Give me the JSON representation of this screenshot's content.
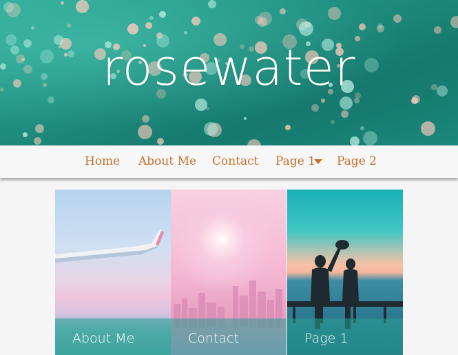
{
  "site": {
    "title": "rosewater"
  },
  "nav": {
    "items": [
      {
        "label": "Home"
      },
      {
        "label": "About Me"
      },
      {
        "label": "Contact"
      },
      {
        "label": "Page 1",
        "has_dropdown": true
      },
      {
        "label": "Page 2"
      }
    ]
  },
  "cards": [
    {
      "label": "About Me",
      "image": "airplane-wing-sky"
    },
    {
      "label": "Contact",
      "image": "pink-city-skyline-sun"
    },
    {
      "label": "Page 1",
      "image": "couple-on-pier-sea"
    }
  ],
  "colors": {
    "accent": "#c8702a",
    "hero_teal": "#1f8f80",
    "nav_bg": "#f7f7f7",
    "page_bg": "#f5f5f5"
  }
}
